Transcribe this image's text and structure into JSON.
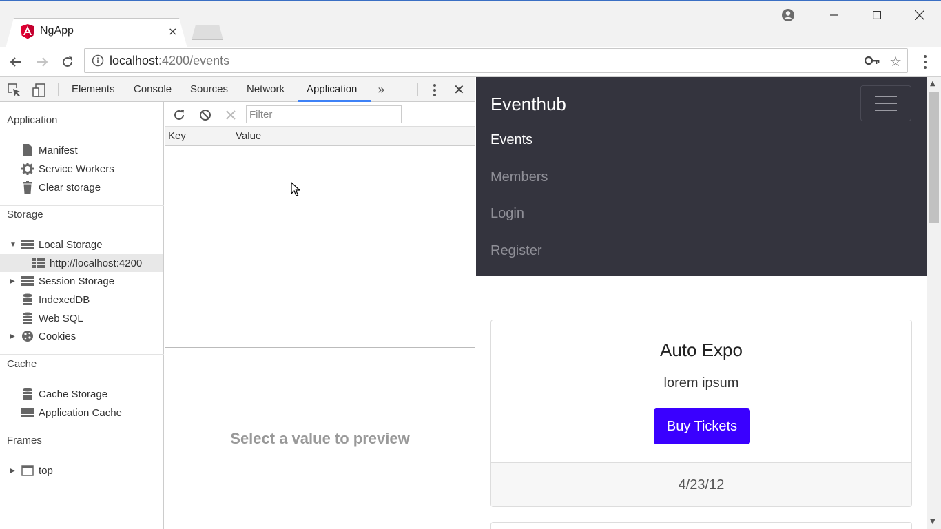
{
  "browser": {
    "tab_title": "NgApp",
    "tab_close": "×",
    "url_host": "localhost",
    "url_path": ":4200/events"
  },
  "devtools": {
    "tabs": [
      "Elements",
      "Console",
      "Sources",
      "Network",
      "Application"
    ],
    "active_tab": "Application",
    "more": "»",
    "close": "✕",
    "sidebar": {
      "application": {
        "title": "Application",
        "items": [
          "Manifest",
          "Service Workers",
          "Clear storage"
        ]
      },
      "storage": {
        "title": "Storage",
        "local_storage": "Local Storage",
        "local_origin": "http://localhost:4200",
        "session_storage": "Session Storage",
        "indexeddb": "IndexedDB",
        "websql": "Web SQL",
        "cookies": "Cookies"
      },
      "cache": {
        "title": "Cache",
        "items": [
          "Cache Storage",
          "Application Cache"
        ]
      },
      "frames": {
        "title": "Frames",
        "top": "top"
      }
    },
    "pane": {
      "filter_placeholder": "Filter",
      "col_key": "Key",
      "col_value": "Value",
      "preview_message": "Select a value to preview"
    }
  },
  "app": {
    "brand": "Eventhub",
    "nav": [
      "Events",
      "Members",
      "Login",
      "Register"
    ],
    "active_nav": "Events",
    "card": {
      "title": "Auto Expo",
      "text": "lorem ipsum",
      "button": "Buy Tickets",
      "date": "4/23/12"
    }
  },
  "colors": {
    "navbar_bg": "#34343e",
    "primary_button": "#3a00ff",
    "devtools_active_underline": "#3e82f7"
  }
}
